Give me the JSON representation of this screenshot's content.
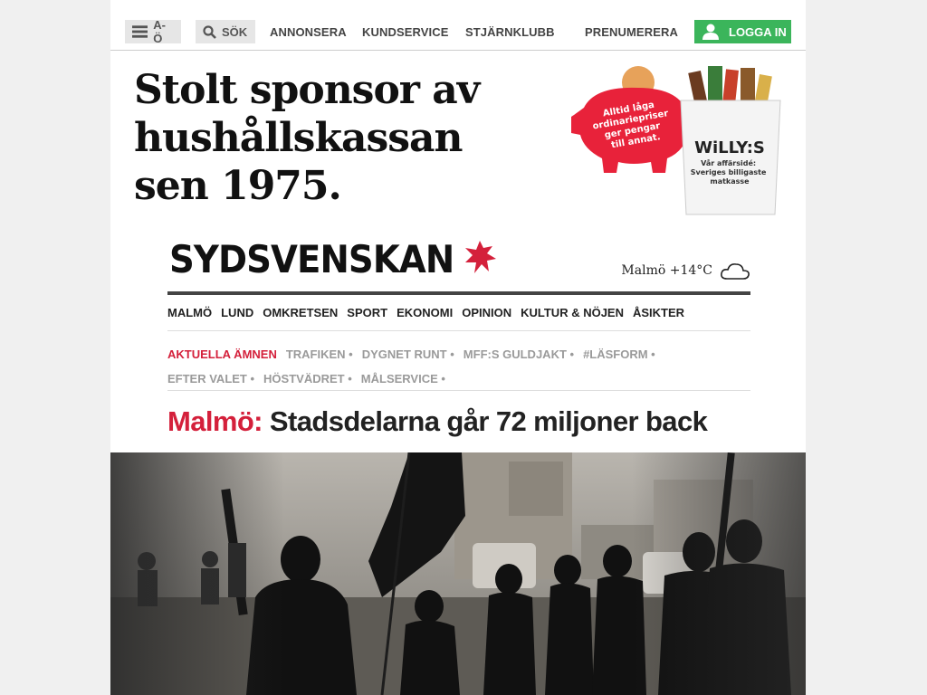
{
  "topbar": {
    "menu_label": "A-Ö",
    "search_label": "SÖK",
    "links": [
      "ANNONSERA",
      "KUNDSERVICE",
      "STJÄRNKLUBB"
    ],
    "subscribe_label": "PRENUMERERA",
    "login_label": "LOGGA IN"
  },
  "ad": {
    "headline_lines": [
      "Stolt sponsor av",
      "hushållskassan",
      "sen 1975."
    ],
    "pig_text": [
      "Alltid låga",
      "ordinariepriser",
      "ger pengar",
      "till annat."
    ],
    "brand": "WiLLY:S",
    "bag_text": [
      "Vår affärsidé:",
      "Sveriges billigaste",
      "matkasse"
    ]
  },
  "masthead": {
    "logo": "SYDSVENSKAN",
    "weather_text": "Malmö +14°C",
    "weather_icon": "cloud-icon"
  },
  "sections": [
    "MALMÖ",
    "LUND",
    "OMKRETSEN",
    "SPORT",
    "EKONOMI",
    "OPINION",
    "KULTUR & NÖJEN",
    "ÅSIKTER"
  ],
  "topics": {
    "active": "AKTUELLA ÄMNEN",
    "items": [
      "TRAFIKEN •",
      "DYGNET RUNT •",
      "MFF:S GULDJAKT •",
      "#LÄSFORM •",
      "EFTER VALET •",
      "HÖSTVÄDRET •",
      "MÅLSERVICE •"
    ]
  },
  "article": {
    "kicker": "Malmö:",
    "headline": "Stadsdelarna går 72 miljoner back"
  },
  "colors": {
    "accent_red": "#d4203b",
    "login_green": "#3bb55b",
    "willys_red": "#e8223a"
  }
}
